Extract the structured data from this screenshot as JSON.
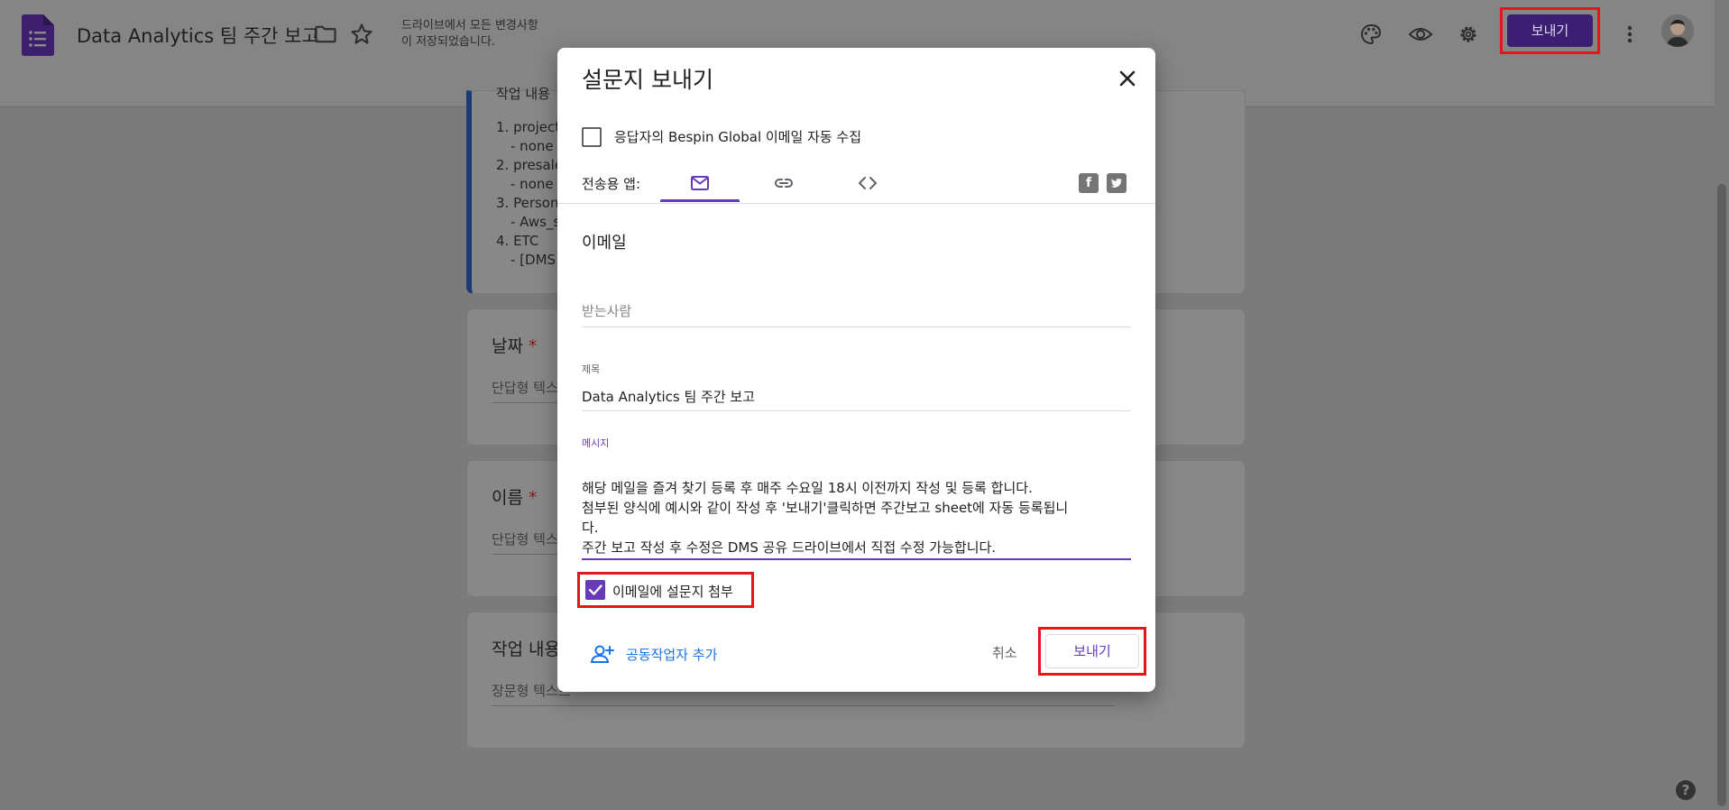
{
  "header": {
    "doc_title": "Data Analytics 팀 주간 보고",
    "save_status_line1": "드라이브에서 모든 변경사항",
    "save_status_line2": "이 저장되었습니다.",
    "send_label": "보내기"
  },
  "form": {
    "description_heading": "작업 내용",
    "description_lines": [
      "1. project/",
      "- none",
      "2. presales",
      "- none",
      "3. Persona",
      "- Aws_s",
      "4. ETC",
      "- [DMS"
    ],
    "questions": [
      {
        "title": "날짜",
        "required": "*",
        "placeholder": "단답형 텍스트"
      },
      {
        "title": "이름",
        "required": "*",
        "placeholder": "단답형 텍스트"
      },
      {
        "title": "작업 내용",
        "required": "",
        "placeholder": "장문형 텍스트"
      }
    ]
  },
  "dialog": {
    "title": "설문지 보내기",
    "collect_email_label": "응답자의 Bespin Global 이메일 자동 수집",
    "collect_email_checked": false,
    "send_via_label": "전송용 앱:",
    "tabs": [
      "email-tab",
      "link-tab",
      "embed-tab"
    ],
    "active_tab": "email-tab",
    "section_title": "이메일",
    "to_placeholder": "받는사람",
    "subject_label": "제목",
    "subject_value": "Data Analytics 팀 주간 보고",
    "message_label": "메시지",
    "message_lines": [
      "해당 메일을 즐겨 찾기 등록 후 매주 수요일 18시 이전까지 작성 및 등록 합니다.",
      "첨부된 양식에 예시와 같이 작성 후 '보내기'클릭하면 주간보고 sheet에 자동 등록됩니",
      "다.",
      "주간 보고 작성 후 수정은 DMS 공유 드라이브에서 직접 수정 가능합니다."
    ],
    "include_form_label": "이메일에 설문지 첨부",
    "include_form_checked": true,
    "add_collaborators_label": "공동작업자 추가",
    "cancel_label": "취소",
    "send_label": "보내기"
  },
  "colors": {
    "accent": "#673ab7",
    "highlight_box": "#e8141c",
    "link_blue": "#1a73e8"
  }
}
